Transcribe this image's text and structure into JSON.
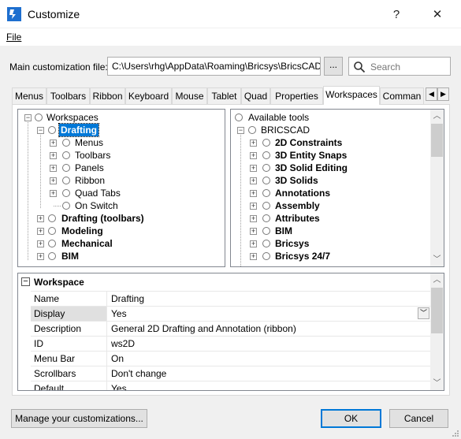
{
  "window": {
    "title": "Customize",
    "help": "?",
    "close": "✕"
  },
  "menubar": {
    "file": "File"
  },
  "customization_file": {
    "label": "Main customization file:",
    "value": "C:\\Users\\rhg\\AppData\\Roaming\\Bricsys\\BricsCAD\\",
    "browse": "...",
    "search_placeholder": "Search"
  },
  "tabs": [
    "Menus",
    "Toolbars",
    "Ribbon",
    "Keyboard",
    "Mouse",
    "Tablet",
    "Quad",
    "Properties",
    "Workspaces",
    "Comman"
  ],
  "active_tab": "Workspaces",
  "left_tree": {
    "root": "Workspaces",
    "selected": "Drafting",
    "children": [
      "Menus",
      "Toolbars",
      "Panels",
      "Ribbon",
      "Quad Tabs",
      "On Switch"
    ],
    "siblings": [
      "Drafting (toolbars)",
      "Modeling",
      "Mechanical",
      "BIM"
    ]
  },
  "right_tree": {
    "root": "Available tools",
    "group": "BRICSCAD",
    "items": [
      "2D Constraints",
      "3D Entity Snaps",
      "3D Solid Editing",
      "3D Solids",
      "Annotations",
      "Assembly",
      "Attributes",
      "BIM",
      "Bricsys",
      "Bricsys 24/7"
    ]
  },
  "properties": {
    "section": "Workspace",
    "rows": [
      {
        "name": "Name",
        "value": "Drafting"
      },
      {
        "name": "Display",
        "value": "Yes"
      },
      {
        "name": "Description",
        "value": "General 2D Drafting and Annotation (ribbon)"
      },
      {
        "name": "ID",
        "value": "ws2D"
      },
      {
        "name": "Menu Bar",
        "value": "On"
      },
      {
        "name": "Scrollbars",
        "value": "Don't change"
      },
      {
        "name": "Default",
        "value": "Yes"
      }
    ]
  },
  "buttons": {
    "manage": "Manage your customizations...",
    "ok": "OK",
    "cancel": "Cancel"
  },
  "colors": {
    "accent": "#0078d7",
    "app_icon": "#1e6fcf"
  }
}
